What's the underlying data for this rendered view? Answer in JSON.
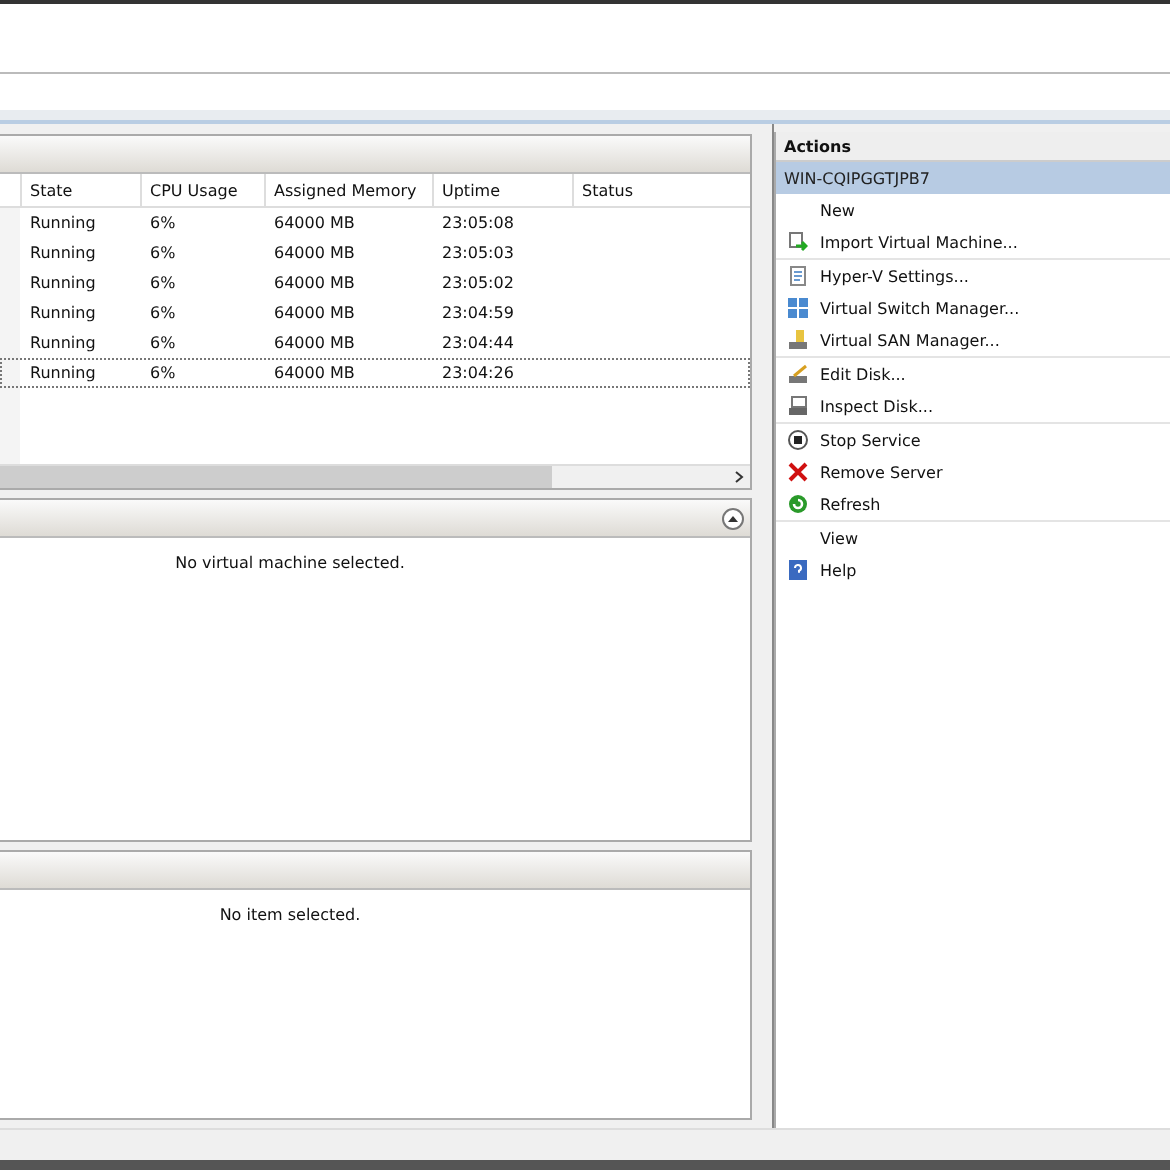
{
  "vm_list": {
    "columns": [
      "State",
      "CPU Usage",
      "Assigned Memory",
      "Uptime",
      "Status"
    ],
    "rows": [
      {
        "cells": [
          "Running",
          "6%",
          "64000 MB",
          "23:05:08"
        ],
        "selected": false
      },
      {
        "cells": [
          "Running",
          "6%",
          "64000 MB",
          "23:05:03"
        ],
        "selected": false
      },
      {
        "cells": [
          "Running",
          "6%",
          "64000 MB",
          "23:05:02"
        ],
        "selected": false
      },
      {
        "cells": [
          "Running",
          "6%",
          "64000 MB",
          "23:04:59"
        ],
        "selected": false
      },
      {
        "cells": [
          "Running",
          "6%",
          "64000 MB",
          "23:04:44"
        ],
        "selected": false
      },
      {
        "cells": [
          "Running",
          "6%",
          "64000 MB",
          "23:04:26"
        ],
        "selected": true
      }
    ]
  },
  "details_panel": {
    "message": "No virtual machine selected."
  },
  "bottom_panel": {
    "message": "No item selected."
  },
  "actions": {
    "title": "Actions",
    "server": "WIN-CQIPGGTJPB7",
    "items": [
      {
        "label": "New",
        "kind": "plain",
        "separator_before": false
      },
      {
        "label": "Import Virtual Machine...",
        "kind": "import",
        "separator_before": false
      },
      {
        "label": "Hyper-V Settings...",
        "kind": "settings",
        "separator_before": true
      },
      {
        "label": "Virtual Switch Manager...",
        "kind": "switch",
        "separator_before": false
      },
      {
        "label": "Virtual SAN Manager...",
        "kind": "san",
        "separator_before": false
      },
      {
        "label": "Edit Disk...",
        "kind": "edit",
        "separator_before": true
      },
      {
        "label": "Inspect Disk...",
        "kind": "inspect",
        "separator_before": false
      },
      {
        "label": "Stop Service",
        "kind": "stop",
        "separator_before": true
      },
      {
        "label": "Remove Server",
        "kind": "remove",
        "separator_before": false
      },
      {
        "label": "Refresh",
        "kind": "refresh",
        "separator_before": false
      },
      {
        "label": "View",
        "kind": "plain",
        "separator_before": true
      },
      {
        "label": "Help",
        "kind": "help",
        "separator_before": false
      }
    ]
  }
}
